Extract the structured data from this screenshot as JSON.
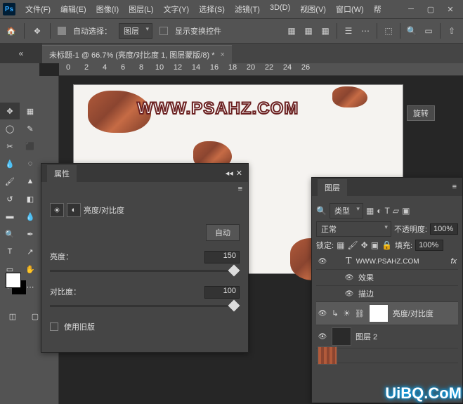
{
  "app": {
    "name": "Ps"
  },
  "menu": {
    "file": "文件(F)",
    "edit": "编辑(E)",
    "image": "图像(I)",
    "layer": "图层(L)",
    "text": "文字(Y)",
    "select": "选择(S)",
    "filter": "滤镜(T)",
    "threeD": "3D(D)",
    "view": "视图(V)",
    "window": "窗口(W)",
    "help": "帮"
  },
  "options": {
    "autoSelect": "自动选择：",
    "autoTarget": "图层",
    "showTransform": "显示变换控件"
  },
  "doc": {
    "title": "未标题-1 @ 66.7% (亮度/对比度 1, 图层蒙版/8) *"
  },
  "ruler": {
    "ticks": [
      "0",
      "2",
      "4",
      "6",
      "8",
      "10",
      "12",
      "14",
      "16",
      "18",
      "20",
      "22",
      "24",
      "26"
    ]
  },
  "tooltip": {
    "rotate": "旋转"
  },
  "canvas": {
    "watermark": "WWW.PSAHZ.COM"
  },
  "props": {
    "title": "属性",
    "adjTitle": "亮度/对比度",
    "auto": "自动",
    "brightness": "亮度：",
    "brightnessVal": "150",
    "contrast": "对比度：",
    "contrastVal": "100",
    "legacy": "使用旧版"
  },
  "layers": {
    "title": "图层",
    "filterLabel": "类型",
    "blendMode": "正常",
    "opacityLabel": "不透明度:",
    "opacityVal": "100%",
    "lockLabel": "锁定:",
    "fillLabel": "填充:",
    "fillVal": "100%",
    "items": {
      "text": "WWW.PSAHZ.COM",
      "fx": "fx",
      "effects": "效果",
      "stroke": "描边",
      "adj": "亮度/对比度",
      "layer2": "图层 2"
    }
  },
  "watermark2": "UiBQ.CoM"
}
